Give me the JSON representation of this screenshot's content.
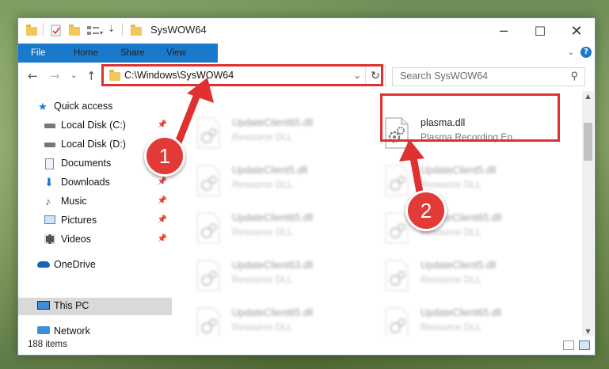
{
  "window": {
    "title": "SysWOW64"
  },
  "ribbon": {
    "tabs": [
      "File",
      "Home",
      "Share",
      "View"
    ],
    "help": "?"
  },
  "address": {
    "path": "C:\\Windows\\SysWOW64"
  },
  "search": {
    "placeholder": "Search SysWOW64"
  },
  "nav": {
    "items": [
      {
        "label": "Quick access",
        "icon": "star-icon",
        "pinned": false
      },
      {
        "label": "Local Disk (C:)",
        "icon": "drive-icon",
        "pinned": true
      },
      {
        "label": "Local Disk (D:)",
        "icon": "drive-icon",
        "pinned": false
      },
      {
        "label": "Documents",
        "icon": "documents-icon",
        "pinned": true
      },
      {
        "label": "Downloads",
        "icon": "download-icon",
        "pinned": true
      },
      {
        "label": "Music",
        "icon": "music-icon",
        "pinned": true
      },
      {
        "label": "Pictures",
        "icon": "pictures-icon",
        "pinned": true
      },
      {
        "label": "Videos",
        "icon": "videos-icon",
        "pinned": true
      },
      {
        "label": "OneDrive",
        "icon": "cloud-icon",
        "pinned": false
      },
      {
        "label": "This PC",
        "icon": "computer-icon",
        "pinned": false,
        "selected": true
      },
      {
        "label": "Network",
        "icon": "network-icon",
        "pinned": false
      }
    ]
  },
  "files": {
    "left": [
      {
        "name": "UpdateClient65.dll",
        "type": "Resource DLL"
      },
      {
        "name": "UpdateClient5.dll",
        "type": "Resource DLL"
      },
      {
        "name": "UpdateClient65.dll",
        "type": "Resource DLL"
      },
      {
        "name": "UpdateClient63.dll",
        "type": "Resource DLL"
      },
      {
        "name": "UpdateClient65.dll",
        "type": "Resource DLL"
      }
    ],
    "right": [
      {
        "name": "plasma.dll",
        "type": "Plasma Recording En..."
      },
      {
        "name": "UpdateClient5.dll",
        "type": "Resource DLL"
      },
      {
        "name": "UpdateClient65.dll",
        "type": "Resource DLL"
      },
      {
        "name": "UpdateClient5.dll",
        "type": "Resource DLL"
      },
      {
        "name": "UpdateClient65.dll",
        "type": "Resource DLL"
      }
    ]
  },
  "status": {
    "count": "188 items"
  },
  "annotations": {
    "step1": "1",
    "step2": "2",
    "color": "#e0302f"
  }
}
